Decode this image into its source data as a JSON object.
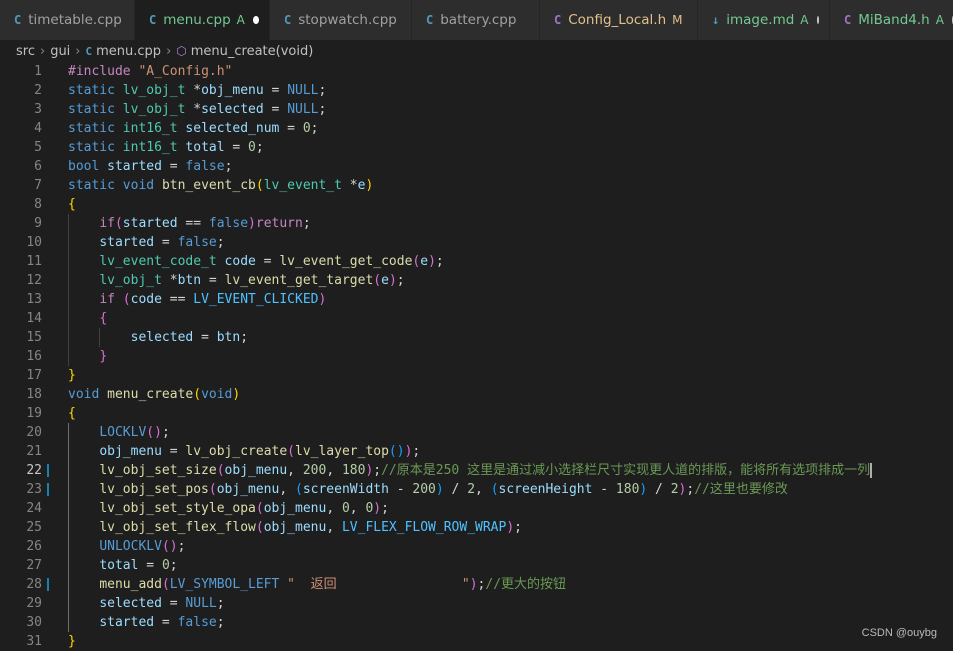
{
  "tabs": [
    {
      "icon": "C",
      "iconColor": "#519aba",
      "name": "timetable.cpp",
      "status": "",
      "statusColor": "",
      "dot": false,
      "active": false,
      "nameColor": "#a0a0a0",
      "width": 135
    },
    {
      "icon": "C",
      "iconColor": "#519aba",
      "name": "menu.cpp",
      "status": "A",
      "statusColor": "#73c991",
      "dot": true,
      "active": true,
      "nameColor": "#73c991",
      "width": 135
    },
    {
      "icon": "C",
      "iconColor": "#519aba",
      "name": "stopwatch.cpp",
      "status": "",
      "statusColor": "",
      "dot": false,
      "active": false,
      "nameColor": "#a0a0a0",
      "width": 142
    },
    {
      "icon": "C",
      "iconColor": "#519aba",
      "name": "battery.cpp",
      "status": "",
      "statusColor": "",
      "dot": false,
      "active": false,
      "nameColor": "#a0a0a0",
      "width": 128
    },
    {
      "icon": "C",
      "iconColor": "#a074c4",
      "name": "Config_Local.h",
      "status": "M",
      "statusColor": "#e2c08d",
      "dot": false,
      "active": false,
      "nameColor": "#e2c08d",
      "width": 158
    },
    {
      "icon": "↓",
      "iconColor": "#519aba",
      "name": "image.md",
      "status": "A",
      "statusColor": "#73c991",
      "dot": true,
      "active": false,
      "nameColor": "#73c991",
      "width": 132
    },
    {
      "icon": "C",
      "iconColor": "#a074c4",
      "name": "MiBand4.h",
      "status": "A",
      "statusColor": "#73c991",
      "dot": true,
      "active": false,
      "nameColor": "#73c991",
      "width": 135
    }
  ],
  "breadcrumb": {
    "part1": "src",
    "part2": "gui",
    "file": "menu.cpp",
    "symbol": "menu_create(void)",
    "fileIcon": "C"
  },
  "currentLine": 22,
  "lines": [
    {
      "n": "1",
      "mod": false,
      "guides": 0,
      "tokens": [
        [
          "t-ctl",
          "#include "
        ],
        [
          "t-str",
          "\"A_Config.h\""
        ]
      ]
    },
    {
      "n": "2",
      "mod": false,
      "guides": 0,
      "tokens": [
        [
          "t-kw",
          "static "
        ],
        [
          "t-ty",
          "lv_obj_t "
        ],
        [
          "t-op",
          "*"
        ],
        [
          "t-var",
          "obj_menu"
        ],
        [
          "t-op",
          " = "
        ],
        [
          "t-kw",
          "NULL"
        ],
        [
          "t-op",
          ";"
        ]
      ]
    },
    {
      "n": "3",
      "mod": false,
      "guides": 0,
      "tokens": [
        [
          "t-kw",
          "static "
        ],
        [
          "t-ty",
          "lv_obj_t "
        ],
        [
          "t-op",
          "*"
        ],
        [
          "t-var",
          "selected"
        ],
        [
          "t-op",
          " = "
        ],
        [
          "t-kw",
          "NULL"
        ],
        [
          "t-op",
          ";"
        ]
      ]
    },
    {
      "n": "4",
      "mod": false,
      "guides": 0,
      "tokens": [
        [
          "t-kw",
          "static "
        ],
        [
          "t-ty",
          "int16_t "
        ],
        [
          "t-var",
          "selected_num"
        ],
        [
          "t-op",
          " = "
        ],
        [
          "t-num",
          "0"
        ],
        [
          "t-op",
          ";"
        ]
      ]
    },
    {
      "n": "5",
      "mod": false,
      "guides": 0,
      "tokens": [
        [
          "t-kw",
          "static "
        ],
        [
          "t-ty",
          "int16_t "
        ],
        [
          "t-var",
          "total"
        ],
        [
          "t-op",
          " = "
        ],
        [
          "t-num",
          "0"
        ],
        [
          "t-op",
          ";"
        ]
      ]
    },
    {
      "n": "6",
      "mod": false,
      "guides": 0,
      "tokens": [
        [
          "t-kw",
          "bool "
        ],
        [
          "t-var",
          "started"
        ],
        [
          "t-op",
          " = "
        ],
        [
          "t-kw",
          "false"
        ],
        [
          "t-op",
          ";"
        ]
      ]
    },
    {
      "n": "7",
      "mod": false,
      "guides": 0,
      "tokens": [
        [
          "t-kw",
          "static "
        ],
        [
          "t-kw",
          "void "
        ],
        [
          "t-fn",
          "btn_event_cb"
        ],
        [
          "t-b1",
          "("
        ],
        [
          "t-ty",
          "lv_event_t "
        ],
        [
          "t-op",
          "*"
        ],
        [
          "t-var",
          "e"
        ],
        [
          "t-b1",
          ")"
        ]
      ]
    },
    {
      "n": "8",
      "mod": false,
      "guides": 0,
      "tokens": [
        [
          "t-b1",
          "{"
        ]
      ]
    },
    {
      "n": "9",
      "mod": false,
      "guides": 1,
      "tokens": [
        [
          "t-op",
          "    "
        ],
        [
          "t-ctl",
          "if"
        ],
        [
          "t-b2",
          "("
        ],
        [
          "t-var",
          "started"
        ],
        [
          "t-op",
          " == "
        ],
        [
          "t-kw",
          "false"
        ],
        [
          "t-b2",
          ")"
        ],
        [
          "t-ctl",
          "return"
        ],
        [
          "t-op",
          ";"
        ]
      ]
    },
    {
      "n": "10",
      "mod": false,
      "guides": 1,
      "tokens": [
        [
          "t-op",
          "    "
        ],
        [
          "t-var",
          "started"
        ],
        [
          "t-op",
          " = "
        ],
        [
          "t-kw",
          "false"
        ],
        [
          "t-op",
          ";"
        ]
      ]
    },
    {
      "n": "11",
      "mod": false,
      "guides": 1,
      "tokens": [
        [
          "t-op",
          "    "
        ],
        [
          "t-ty",
          "lv_event_code_t "
        ],
        [
          "t-var",
          "code"
        ],
        [
          "t-op",
          " = "
        ],
        [
          "t-fn",
          "lv_event_get_code"
        ],
        [
          "t-b2",
          "("
        ],
        [
          "t-var",
          "e"
        ],
        [
          "t-b2",
          ")"
        ],
        [
          "t-op",
          ";"
        ]
      ]
    },
    {
      "n": "12",
      "mod": false,
      "guides": 1,
      "tokens": [
        [
          "t-op",
          "    "
        ],
        [
          "t-ty",
          "lv_obj_t "
        ],
        [
          "t-op",
          "*"
        ],
        [
          "t-var",
          "btn"
        ],
        [
          "t-op",
          " = "
        ],
        [
          "t-fn",
          "lv_event_get_target"
        ],
        [
          "t-b2",
          "("
        ],
        [
          "t-var",
          "e"
        ],
        [
          "t-b2",
          ")"
        ],
        [
          "t-op",
          ";"
        ]
      ]
    },
    {
      "n": "13",
      "mod": false,
      "guides": 1,
      "tokens": [
        [
          "t-op",
          "    "
        ],
        [
          "t-ctl",
          "if "
        ],
        [
          "t-b2",
          "("
        ],
        [
          "t-var",
          "code"
        ],
        [
          "t-op",
          " == "
        ],
        [
          "t-mac",
          "LV_EVENT_CLICKED"
        ],
        [
          "t-b2",
          ")"
        ]
      ]
    },
    {
      "n": "14",
      "mod": false,
      "guides": 1,
      "tokens": [
        [
          "t-op",
          "    "
        ],
        [
          "t-b2",
          "{"
        ]
      ]
    },
    {
      "n": "15",
      "mod": false,
      "guides": 2,
      "tokens": [
        [
          "t-op",
          "        "
        ],
        [
          "t-var",
          "selected"
        ],
        [
          "t-op",
          " = "
        ],
        [
          "t-var",
          "btn"
        ],
        [
          "t-op",
          ";"
        ]
      ]
    },
    {
      "n": "16",
      "mod": false,
      "guides": 1,
      "tokens": [
        [
          "t-op",
          "    "
        ],
        [
          "t-b2",
          "}"
        ]
      ]
    },
    {
      "n": "17",
      "mod": false,
      "guides": 0,
      "tokens": [
        [
          "t-b1",
          "}"
        ]
      ]
    },
    {
      "n": "18",
      "mod": false,
      "guides": 0,
      "tokens": [
        [
          "t-kw",
          "void "
        ],
        [
          "t-fn",
          "menu_create"
        ],
        [
          "t-b1",
          "("
        ],
        [
          "t-kw",
          "void"
        ],
        [
          "t-b1",
          ")"
        ]
      ]
    },
    {
      "n": "19",
      "mod": false,
      "guides": 0,
      "tokens": [
        [
          "t-b1",
          "{"
        ]
      ]
    },
    {
      "n": "20",
      "mod": false,
      "guides": 1,
      "tokens": [
        [
          "t-op",
          "    "
        ],
        [
          "t-kw",
          "LOCKLV"
        ],
        [
          "t-b2",
          "()"
        ],
        [
          "t-op",
          ";"
        ]
      ]
    },
    {
      "n": "21",
      "mod": false,
      "guides": 1,
      "tokens": [
        [
          "t-op",
          "    "
        ],
        [
          "t-var",
          "obj_menu"
        ],
        [
          "t-op",
          " = "
        ],
        [
          "t-fn",
          "lv_obj_create"
        ],
        [
          "t-b2",
          "("
        ],
        [
          "t-fn",
          "lv_layer_top"
        ],
        [
          "t-b3",
          "()"
        ],
        [
          "t-b2",
          ")"
        ],
        [
          "t-op",
          ";"
        ]
      ]
    },
    {
      "n": "22",
      "mod": true,
      "guides": 1,
      "cursor": true,
      "tokens": [
        [
          "t-op",
          "    "
        ],
        [
          "t-fn",
          "lv_obj_set_size"
        ],
        [
          "t-b2",
          "("
        ],
        [
          "t-var",
          "obj_menu"
        ],
        [
          "t-op",
          ", "
        ],
        [
          "t-num",
          "200"
        ],
        [
          "t-op",
          ", "
        ],
        [
          "t-num",
          "180"
        ],
        [
          "t-b2",
          ")"
        ],
        [
          "t-op",
          ";"
        ],
        [
          "t-cm",
          "//原本是250 这里是通过减小选择栏尺寸实现更人道的排版，能将所有选项排成一列"
        ]
      ]
    },
    {
      "n": "23",
      "mod": true,
      "guides": 1,
      "tokens": [
        [
          "t-op",
          "    "
        ],
        [
          "t-fn",
          "lv_obj_set_pos"
        ],
        [
          "t-b2",
          "("
        ],
        [
          "t-var",
          "obj_menu"
        ],
        [
          "t-op",
          ", "
        ],
        [
          "t-b3",
          "("
        ],
        [
          "t-var",
          "screenWidth"
        ],
        [
          "t-op",
          " - "
        ],
        [
          "t-num",
          "200"
        ],
        [
          "t-b3",
          ")"
        ],
        [
          "t-op",
          " / "
        ],
        [
          "t-num",
          "2"
        ],
        [
          "t-op",
          ", "
        ],
        [
          "t-b3",
          "("
        ],
        [
          "t-var",
          "screenHeight"
        ],
        [
          "t-op",
          " - "
        ],
        [
          "t-num",
          "180"
        ],
        [
          "t-b3",
          ")"
        ],
        [
          "t-op",
          " / "
        ],
        [
          "t-num",
          "2"
        ],
        [
          "t-b2",
          ")"
        ],
        [
          "t-op",
          ";"
        ],
        [
          "t-cm",
          "//这里也要修改"
        ]
      ]
    },
    {
      "n": "24",
      "mod": false,
      "guides": 1,
      "tokens": [
        [
          "t-op",
          "    "
        ],
        [
          "t-fn",
          "lv_obj_set_style_opa"
        ],
        [
          "t-b2",
          "("
        ],
        [
          "t-var",
          "obj_menu"
        ],
        [
          "t-op",
          ", "
        ],
        [
          "t-num",
          "0"
        ],
        [
          "t-op",
          ", "
        ],
        [
          "t-num",
          "0"
        ],
        [
          "t-b2",
          ")"
        ],
        [
          "t-op",
          ";"
        ]
      ]
    },
    {
      "n": "25",
      "mod": false,
      "guides": 1,
      "tokens": [
        [
          "t-op",
          "    "
        ],
        [
          "t-fn",
          "lv_obj_set_flex_flow"
        ],
        [
          "t-b2",
          "("
        ],
        [
          "t-var",
          "obj_menu"
        ],
        [
          "t-op",
          ", "
        ],
        [
          "t-mac",
          "LV_FLEX_FLOW_ROW_WRAP"
        ],
        [
          "t-b2",
          ")"
        ],
        [
          "t-op",
          ";"
        ]
      ]
    },
    {
      "n": "26",
      "mod": false,
      "guides": 1,
      "tokens": [
        [
          "t-op",
          "    "
        ],
        [
          "t-kw",
          "UNLOCKLV"
        ],
        [
          "t-b2",
          "()"
        ],
        [
          "t-op",
          ";"
        ]
      ]
    },
    {
      "n": "27",
      "mod": false,
      "guides": 1,
      "tokens": [
        [
          "t-op",
          "    "
        ],
        [
          "t-var",
          "total"
        ],
        [
          "t-op",
          " = "
        ],
        [
          "t-num",
          "0"
        ],
        [
          "t-op",
          ";"
        ]
      ]
    },
    {
      "n": "28",
      "mod": true,
      "guides": 1,
      "tokens": [
        [
          "t-op",
          "    "
        ],
        [
          "t-fn",
          "menu_add"
        ],
        [
          "t-b2",
          "("
        ],
        [
          "t-kw",
          "LV_SYMBOL_LEFT"
        ],
        [
          "t-str",
          " \"  返回                \""
        ],
        [
          "t-b2",
          ")"
        ],
        [
          "t-op",
          ";"
        ],
        [
          "t-cm",
          "//更大的按钮"
        ]
      ]
    },
    {
      "n": "29",
      "mod": false,
      "guides": 1,
      "tokens": [
        [
          "t-op",
          "    "
        ],
        [
          "t-var",
          "selected"
        ],
        [
          "t-op",
          " = "
        ],
        [
          "t-kw",
          "NULL"
        ],
        [
          "t-op",
          ";"
        ]
      ]
    },
    {
      "n": "30",
      "mod": false,
      "guides": 1,
      "tokens": [
        [
          "t-op",
          "    "
        ],
        [
          "t-var",
          "started"
        ],
        [
          "t-op",
          " = "
        ],
        [
          "t-kw",
          "false"
        ],
        [
          "t-op",
          ";"
        ]
      ]
    },
    {
      "n": "31",
      "mod": false,
      "guides": 0,
      "tokens": [
        [
          "t-b1",
          "}"
        ]
      ]
    }
  ],
  "watermark": "CSDN @ouybg"
}
